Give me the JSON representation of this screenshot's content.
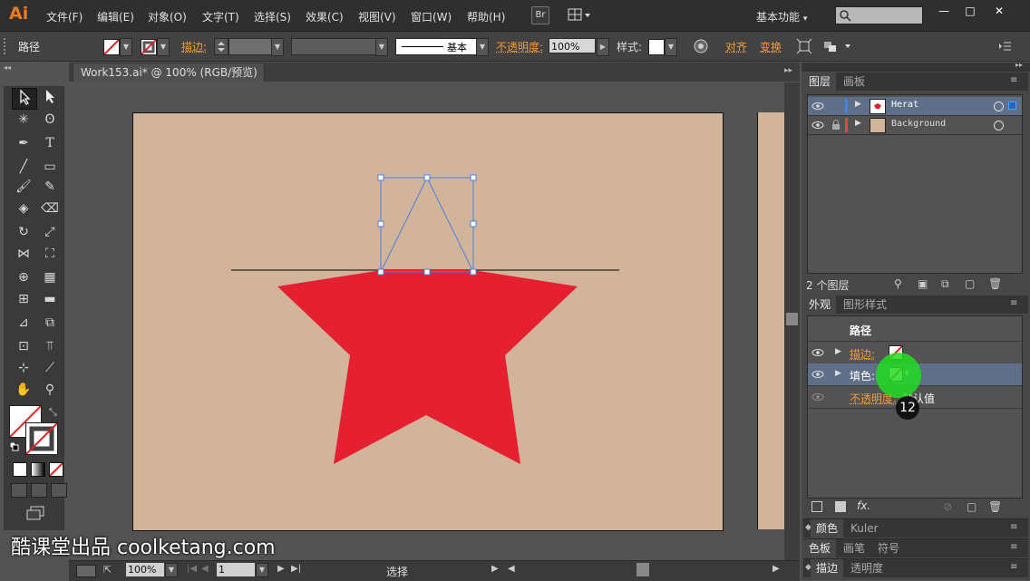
{
  "app": {
    "logo": "Ai",
    "br_button": "Br",
    "arrange_icon": "arrange-documents-icon",
    "workspace": "基本功能",
    "workspace_caret": "▾"
  },
  "menu": [
    "文件(F)",
    "编辑(E)",
    "对象(O)",
    "文字(T)",
    "选择(S)",
    "效果(C)",
    "视图(V)",
    "窗口(W)",
    "帮助(H)"
  ],
  "window_controls": {
    "minimize": "—",
    "maximize": "□",
    "close": "✕"
  },
  "control_bar": {
    "selection_type": "路径",
    "stroke_label": "描边:",
    "stroke_profile": "基本",
    "opacity_label": "不透明度:",
    "opacity_value": "100%",
    "style_label": "样式:",
    "align_label": "对齐",
    "transform_label": "变换"
  },
  "document": {
    "tab_title": "Work153.ai* @ 100% (RGB/预览)",
    "tab_close": "✕"
  },
  "status_bar": {
    "zoom": "100%",
    "page": "1",
    "tool": "选择"
  },
  "layers_panel": {
    "tabs": [
      "图层",
      "画板"
    ],
    "layers": [
      {
        "name": "Herat",
        "color": "#4a7fe0",
        "selected": true,
        "locked": false
      },
      {
        "name": "Background",
        "color": "#e04848",
        "selected": false,
        "locked": true
      }
    ],
    "footer_count": "2 个图层"
  },
  "appearance_panel": {
    "tabs": [
      "外观",
      "图形样式"
    ],
    "title": "路径",
    "rows": [
      {
        "label": "描边:",
        "type": "stroke"
      },
      {
        "label": "填色:",
        "type": "fill"
      },
      {
        "label": "不透明度:",
        "value": "默认值"
      }
    ],
    "fx_label": "fx."
  },
  "collapsed_panels": [
    {
      "tabs": [
        "颜色",
        "Kuler"
      ]
    },
    {
      "tabs": [
        "色板",
        "画笔",
        "符号"
      ]
    },
    {
      "tabs": [
        "描边",
        "透明度"
      ]
    }
  ],
  "click_indicator": {
    "number": "12",
    "color": "#22dd22"
  },
  "colors": {
    "star_fill": "#e52030",
    "artboard": "#d2b49b",
    "selection": "#4a7fe0"
  },
  "watermark": "酷课堂出品 coolketang.com"
}
